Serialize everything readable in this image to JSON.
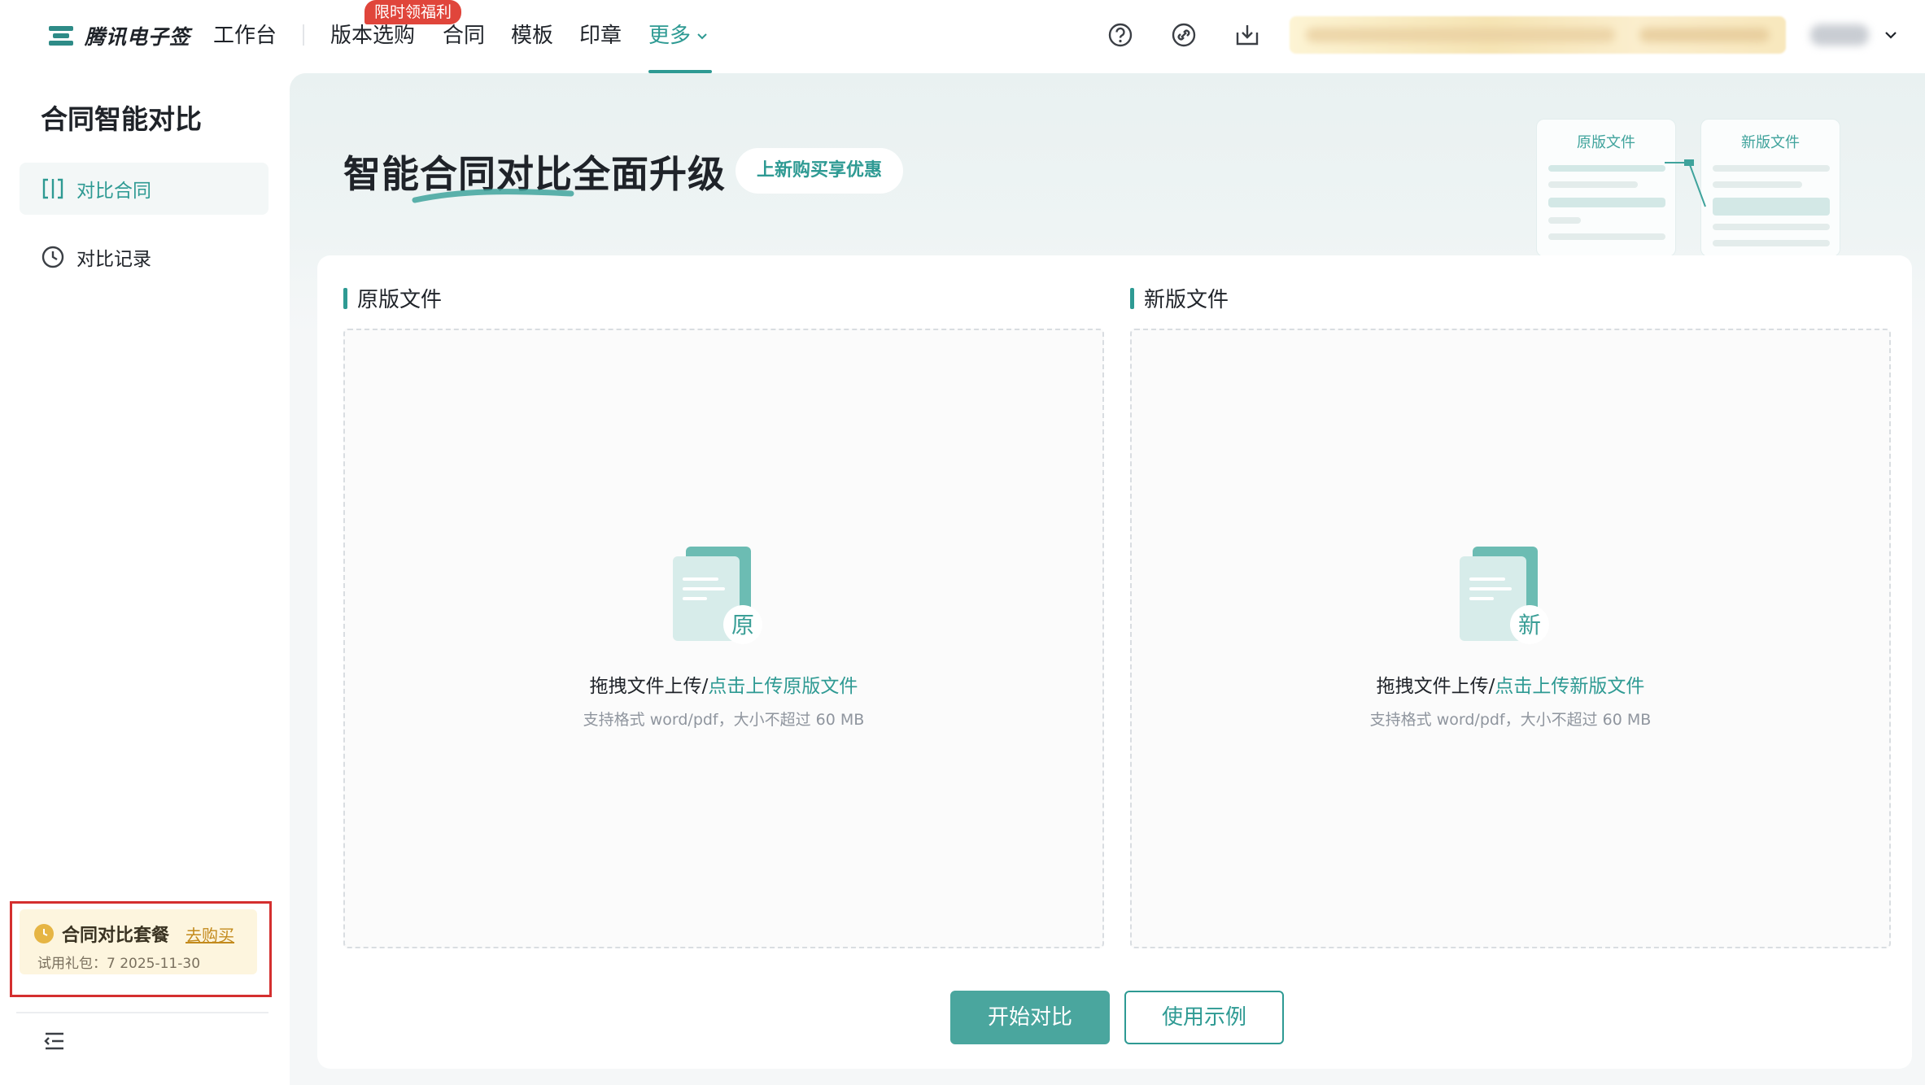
{
  "app": {
    "logo_text": "腾讯电子签",
    "brand_color": "#2e9a93"
  },
  "topnav": {
    "items": [
      {
        "label": "工作台"
      },
      {
        "label": "版本选购"
      },
      {
        "label": "合同"
      },
      {
        "label": "模板"
      },
      {
        "label": "印章"
      }
    ],
    "more_label": "更多",
    "promo_badge": "限时领福利",
    "icons": [
      "help-circle-icon",
      "link-icon",
      "download-icon"
    ]
  },
  "sidebar": {
    "title": "合同智能对比",
    "items": [
      {
        "label": "对比合同",
        "icon": "compare-icon",
        "active": true
      },
      {
        "label": "对比记录",
        "icon": "clock-icon",
        "active": false
      }
    ],
    "package": {
      "title": "合同对比套餐",
      "buy_label": "去购买",
      "info": "试用礼包：7   2025-11-30"
    }
  },
  "hero": {
    "title": "智能合同对比全面升级",
    "promo": "上新购买享优惠",
    "illustration": {
      "original_label": "原版文件",
      "new_label": "新版文件"
    }
  },
  "upload": {
    "original": {
      "heading": "原版文件",
      "badge": "原",
      "drag_text": "拖拽文件上传/",
      "link_text": "点击上传原版文件",
      "hint": "支持格式 word/pdf，大小不超过 60 MB"
    },
    "new": {
      "heading": "新版文件",
      "badge": "新",
      "drag_text": "拖拽文件上传/",
      "link_text": "点击上传新版文件",
      "hint": "支持格式 word/pdf，大小不超过 60 MB"
    }
  },
  "actions": {
    "start_label": "开始对比",
    "example_label": "使用示例"
  }
}
